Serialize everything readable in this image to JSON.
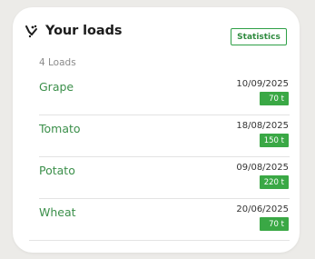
{
  "widget": {
    "title": "Your loads",
    "title_icon": "hand-grain-icon",
    "statistics_label": "Statistics",
    "count_label": "4 Loads"
  },
  "loads": [
    {
      "name": "Grape",
      "date": "10/09/2025",
      "quantity": "70 t"
    },
    {
      "name": "Tomato",
      "date": "18/08/2025",
      "quantity": "150 t"
    },
    {
      "name": "Potato",
      "date": "09/08/2025",
      "quantity": "220 t"
    },
    {
      "name": "Wheat",
      "date": "20/06/2025",
      "quantity": "70 t"
    }
  ],
  "colors": {
    "accent": "#3aa845",
    "crop_name": "#3b8f4a",
    "background": "#ecebe8",
    "card": "#ffffff"
  }
}
